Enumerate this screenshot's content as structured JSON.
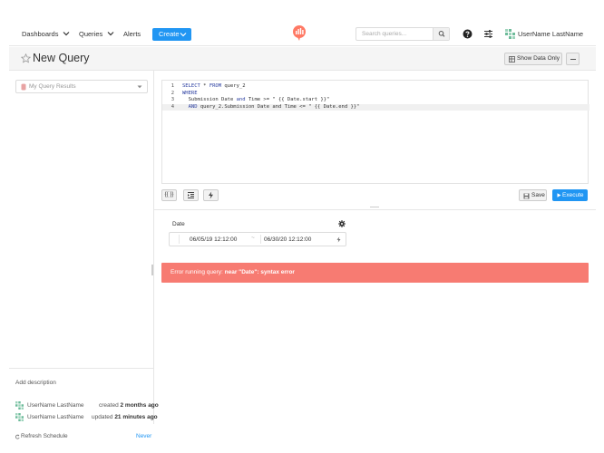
{
  "nav": {
    "dashboards": "Dashboards",
    "queries": "Queries",
    "alerts": "Alerts",
    "create": "Create",
    "search_placeholder": "Search queries...",
    "user_name": "UserName LastName"
  },
  "header": {
    "title": "New Query",
    "show_data_only": "Show Data Only"
  },
  "sidebar": {
    "schema_placeholder": "My Query Results",
    "add_description": "Add description",
    "created_by": "UserName LastName",
    "created_verb": "created",
    "created_when": "2 months ago",
    "updated_by": "UserName LastName",
    "updated_verb": "updated",
    "updated_when": "21 minutes ago",
    "refresh_schedule": "Refresh Schedule",
    "refresh_value": "Never"
  },
  "editor": {
    "lines": [
      {
        "num": "1",
        "kw1": "SELECT",
        "rest1": " * ",
        "kw2": "FROM",
        "rest2": " query_2"
      },
      {
        "num": "2",
        "kw1": "WHERE",
        "rest1": "",
        "kw2": "",
        "rest2": ""
      },
      {
        "num": "3",
        "kw1": "",
        "rest1": "  Submission Date ",
        "kw2": "and",
        "rest2": " Time >= \" {{ Date.start }}\""
      },
      {
        "num": "4",
        "kw1": "",
        "rest1": "  ",
        "kw2": "AND",
        "rest2": " query_2.Submission Date and Time <= \" {{ Date.end }}\""
      }
    ],
    "param_btn": "{{ }}",
    "save": "Save",
    "execute": "Execute"
  },
  "parameter": {
    "label": "Date",
    "start": "06/05/19 12:12:00",
    "separator": "~",
    "end": "06/30/20 12:12:00"
  },
  "error": {
    "prefix": "Error running query: ",
    "detail": "near \"Date\": syntax error"
  },
  "colors": {
    "primary": "#2196f3",
    "error": "#f77b72",
    "logo": "#ff7964"
  }
}
